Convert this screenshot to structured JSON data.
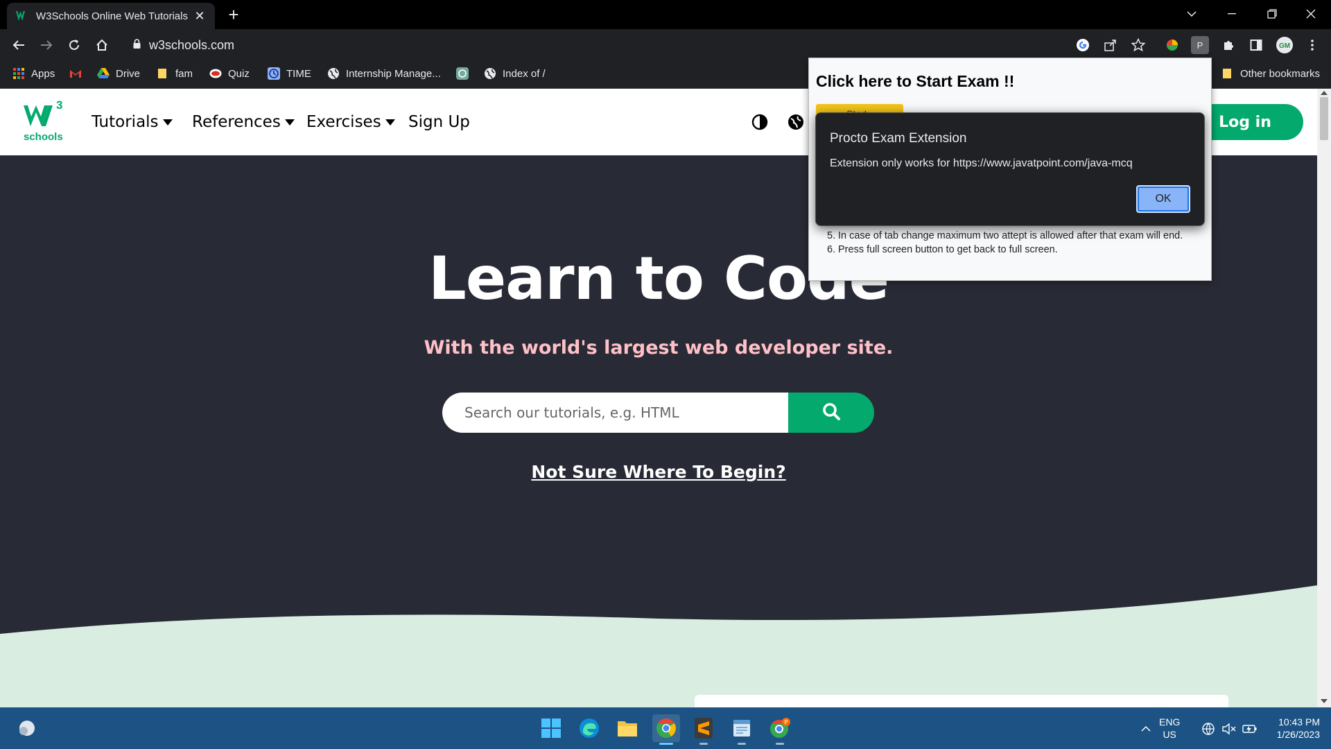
{
  "browser": {
    "tab_title": "W3Schools Online Web Tutorials",
    "url": "w3schools.com",
    "bookmarks": [
      "Apps",
      "Drive",
      "fam",
      "Quiz",
      "TIME",
      "Internship Manage...",
      "Index of /",
      "Other bookmarks"
    ]
  },
  "site": {
    "logo_sup": "3",
    "logo_text": "schools",
    "nav": [
      "Tutorials",
      "References",
      "Exercises",
      "Sign Up"
    ],
    "login_label": "Log in",
    "hero_title": "Learn to Code",
    "hero_subtitle": "With the world's largest web developer site.",
    "search_placeholder": "Search our tutorials, e.g. HTML",
    "not_sure_link": "Not Sure Where To Begin?"
  },
  "extension_popup": {
    "title": "Click here to Start Exam !!",
    "start_label": "Start",
    "rules": [
      {
        "number": "5.",
        "text": "In case of tab change maximum two attept is allowed after that exam will end."
      },
      {
        "number": "6.",
        "text": "Press full screen button to get back to full screen."
      }
    ]
  },
  "alert": {
    "title": "Procto Exam Extension",
    "message": "Extension only works for https://www.javatpoint.com/java-mcq",
    "ok_label": "OK"
  },
  "taskbar": {
    "lang_line1": "ENG",
    "lang_line2": "US",
    "time": "10:43 PM",
    "date": "1/26/2023"
  },
  "colors": {
    "w3_green": "#04aa6d",
    "hero_bg": "#282a35",
    "subtitle_pink": "#ffc0c7",
    "wave": "#d9eee1",
    "taskbar": "#1c5384"
  }
}
